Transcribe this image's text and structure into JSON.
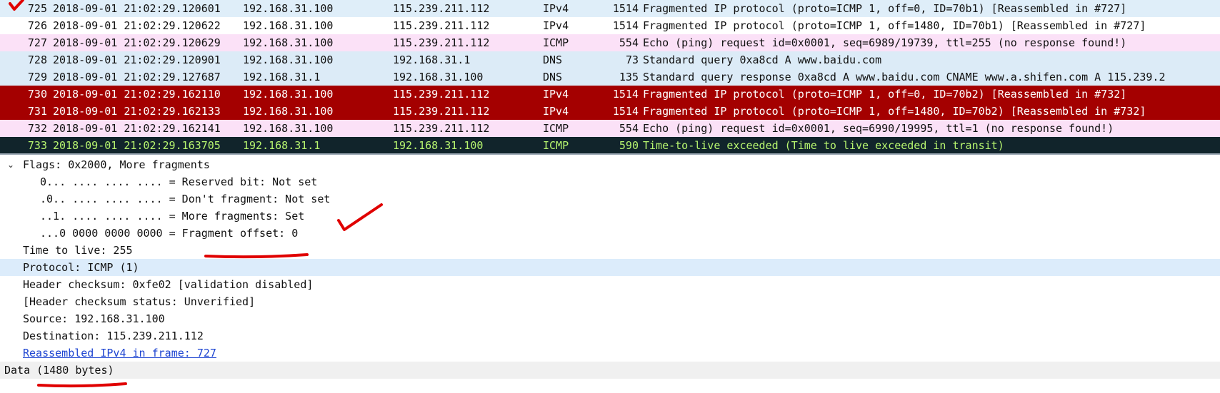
{
  "packet_list": [
    {
      "no": "725",
      "time": "2018-09-01 21:02:29.120601",
      "source": "192.168.31.100",
      "destination": "115.239.211.112",
      "protocol": "IPv4",
      "length": "1514",
      "info": "Fragmented IP protocol (proto=ICMP 1, off=0, ID=70b1) [Reassembled in #727]",
      "bg": "#dfeef9",
      "fg": "#111111"
    },
    {
      "no": "726",
      "time": "2018-09-01 21:02:29.120622",
      "source": "192.168.31.100",
      "destination": "115.239.211.112",
      "protocol": "IPv4",
      "length": "1514",
      "info": "Fragmented IP protocol (proto=ICMP 1, off=1480, ID=70b1) [Reassembled in #727]",
      "bg": "#ffffff",
      "fg": "#111111"
    },
    {
      "no": "727",
      "time": "2018-09-01 21:02:29.120629",
      "source": "192.168.31.100",
      "destination": "115.239.211.112",
      "protocol": "ICMP",
      "length": "554",
      "info": "Echo (ping) request  id=0x0001, seq=6989/19739, ttl=255 (no response found!)",
      "bg": "#fbe1f7",
      "fg": "#111111"
    },
    {
      "no": "728",
      "time": "2018-09-01 21:02:29.120901",
      "source": "192.168.31.100",
      "destination": "192.168.31.1",
      "protocol": "DNS",
      "length": "73",
      "info": "Standard query 0xa8cd A www.baidu.com",
      "bg": "#dcebf7",
      "fg": "#111111"
    },
    {
      "no": "729",
      "time": "2018-09-01 21:02:29.127687",
      "source": "192.168.31.1",
      "destination": "192.168.31.100",
      "protocol": "DNS",
      "length": "135",
      "info": "Standard query response 0xa8cd A www.baidu.com CNAME www.a.shifen.com A 115.239.2",
      "bg": "#dcebf7",
      "fg": "#111111"
    },
    {
      "no": "730",
      "time": "2018-09-01 21:02:29.162110",
      "source": "192.168.31.100",
      "destination": "115.239.211.112",
      "protocol": "IPv4",
      "length": "1514",
      "info": "Fragmented IP protocol (proto=ICMP 1, off=0, ID=70b2) [Reassembled in #732]",
      "bg": "#a40000",
      "fg": "#ffffff"
    },
    {
      "no": "731",
      "time": "2018-09-01 21:02:29.162133",
      "source": "192.168.31.100",
      "destination": "115.239.211.112",
      "protocol": "IPv4",
      "length": "1514",
      "info": "Fragmented IP protocol (proto=ICMP 1, off=1480, ID=70b2) [Reassembled in #732]",
      "bg": "#a40000",
      "fg": "#ffffff"
    },
    {
      "no": "732",
      "time": "2018-09-01 21:02:29.162141",
      "source": "192.168.31.100",
      "destination": "115.239.211.112",
      "protocol": "ICMP",
      "length": "554",
      "info": "Echo (ping) request  id=0x0001, seq=6990/19995, ttl=1 (no response found!)",
      "bg": "#fbe1f7",
      "fg": "#111111"
    },
    {
      "no": "733",
      "time": "2018-09-01 21:02:29.163705",
      "source": "192.168.31.1",
      "destination": "192.168.31.100",
      "protocol": "ICMP",
      "length": "590",
      "info": "Time-to-live exceeded (Time to live exceeded in transit)",
      "bg": "#11242b",
      "fg": "#b7f56f"
    }
  ],
  "details": {
    "flags_header": "Flags: 0x2000, More fragments",
    "reserved_bit": "0... .... .... .... = Reserved bit: Not set",
    "dont_fragment": ".0.. .... .... .... = Don't fragment: Not set",
    "more_fragments": "..1. .... .... .... = More fragments: Set",
    "fragment_offset": "...0 0000 0000 0000 = Fragment offset: 0",
    "ttl": "Time to live: 255",
    "protocol": "Protocol: ICMP (1)",
    "checksum": "Header checksum: 0xfe02 [validation disabled]",
    "checksum_status": "[Header checksum status: Unverified]",
    "source": "Source: 192.168.31.100",
    "destination": "Destination: 115.239.211.112",
    "reassembled": "Reassembled IPv4 in frame: 727",
    "data": "Data (1480 bytes)"
  },
  "icons": {
    "expand": "chevron-down-icon",
    "check_mark": "check-mark-icon",
    "underline": "underline-annotation"
  },
  "colors": {
    "link": "#1d44d1",
    "selected_row": "#dcecfb",
    "annotation_red": "#e00000"
  }
}
